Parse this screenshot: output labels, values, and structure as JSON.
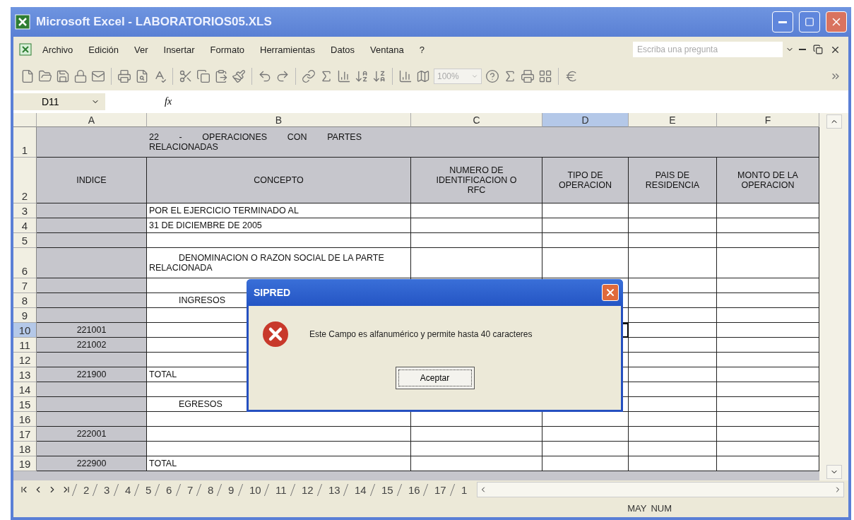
{
  "window": {
    "title": "Microsoft Excel - LABORATORIOS05.XLS"
  },
  "menu": [
    "Archivo",
    "Edición",
    "Ver",
    "Insertar",
    "Formato",
    "Herramientas",
    "Datos",
    "Ventana",
    "?"
  ],
  "help_field": {
    "placeholder": "Escriba una pregunta"
  },
  "toolbar": {
    "zoom": "100%"
  },
  "formula_bar": {
    "name_box": "D11",
    "function_label": "fx"
  },
  "columns": [
    {
      "label": "A",
      "selected": false
    },
    {
      "label": "B",
      "selected": false
    },
    {
      "label": "C",
      "selected": false
    },
    {
      "label": "D",
      "selected": true
    },
    {
      "label": "E",
      "selected": false
    },
    {
      "label": "F",
      "selected": false
    }
  ],
  "rows": [
    {
      "number": "1",
      "kind": "title",
      "selected": false,
      "title": "22 - OPERACIONES CON PARTES RELACIONADAS"
    },
    {
      "number": "2",
      "kind": "header",
      "selected": false,
      "cells": [
        "INDICE",
        "CONCEPTO",
        "NUMERO DE IDENTIFICACION O RFC",
        "TIPO DE OPERACION",
        "PAIS DE RESIDENCIA",
        "MONTO DE LA OPERACION"
      ]
    },
    {
      "number": "3",
      "kind": "data",
      "selected": false,
      "concept": "POR EL EJERCICIO TERMINADO AL"
    },
    {
      "number": "4",
      "kind": "data",
      "selected": false,
      "concept": "31 DE DICIEMBRE DE 2005"
    },
    {
      "number": "5",
      "kind": "data",
      "selected": false
    },
    {
      "number": "6",
      "kind": "tall",
      "selected": false,
      "concept": "DENOMINACION O RAZON SOCIAL DE LA PARTE RELACIONADA"
    },
    {
      "number": "7",
      "kind": "data",
      "selected": false
    },
    {
      "number": "8",
      "kind": "section",
      "selected": false,
      "concept": "INGRESOS"
    },
    {
      "number": "9",
      "kind": "data",
      "selected": false
    },
    {
      "number": "10",
      "kind": "data",
      "selected": true,
      "index": "221001"
    },
    {
      "number": "11",
      "kind": "data",
      "selected": false,
      "index": "221002"
    },
    {
      "number": "12",
      "kind": "data",
      "selected": false
    },
    {
      "number": "13",
      "kind": "data",
      "selected": false,
      "index": "221900",
      "concept": "TOTAL"
    },
    {
      "number": "14",
      "kind": "data",
      "selected": false
    },
    {
      "number": "15",
      "kind": "section",
      "selected": false,
      "concept": "EGRESOS"
    },
    {
      "number": "16",
      "kind": "data",
      "selected": false
    },
    {
      "number": "17",
      "kind": "data",
      "selected": false,
      "index": "222001"
    },
    {
      "number": "18",
      "kind": "data",
      "selected": false
    },
    {
      "number": "19",
      "kind": "data",
      "selected": false,
      "index": "222900",
      "concept": "TOTAL"
    }
  ],
  "sheet_tabs": [
    "2",
    "3",
    "4",
    "5",
    "6",
    "7",
    "8",
    "9",
    "10",
    "11",
    "12",
    "13",
    "14",
    "15",
    "16",
    "17",
    "1"
  ],
  "status_bar": [
    "MAY",
    "NUM"
  ],
  "dialog": {
    "title": "SIPRED",
    "message": "Este Campo es alfanumérico y permite hasta 40 caracteres",
    "button": "Aceptar"
  }
}
